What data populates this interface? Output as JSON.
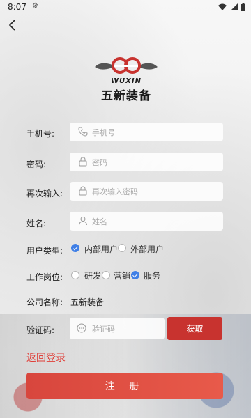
{
  "status": {
    "time": "8:07"
  },
  "brand": {
    "en": "WUXIN",
    "cn": "五新装备",
    "color": "#c8332f"
  },
  "form": {
    "phone": {
      "label": "手机号:",
      "placeholder": "手机号"
    },
    "password": {
      "label": "密码:",
      "placeholder": "密码"
    },
    "confirm": {
      "label": "再次输入:",
      "placeholder": "再次输入密码"
    },
    "name": {
      "label": "姓名:",
      "placeholder": "姓名"
    },
    "user_type": {
      "label": "用户类型:",
      "options": [
        {
          "label": "内部用户",
          "checked": true
        },
        {
          "label": "外部用户",
          "checked": false
        }
      ]
    },
    "position": {
      "label": "工作岗位:",
      "options": [
        {
          "label": "研发",
          "checked": false
        },
        {
          "label": "营销",
          "checked": false
        },
        {
          "label": "服务",
          "checked": true
        }
      ]
    },
    "company": {
      "label": "公司名称:",
      "value": "五新装备"
    },
    "code": {
      "label": "验证码:",
      "placeholder": "验证码",
      "button": "获取"
    }
  },
  "back_login": "返回登录",
  "register": "注 册"
}
